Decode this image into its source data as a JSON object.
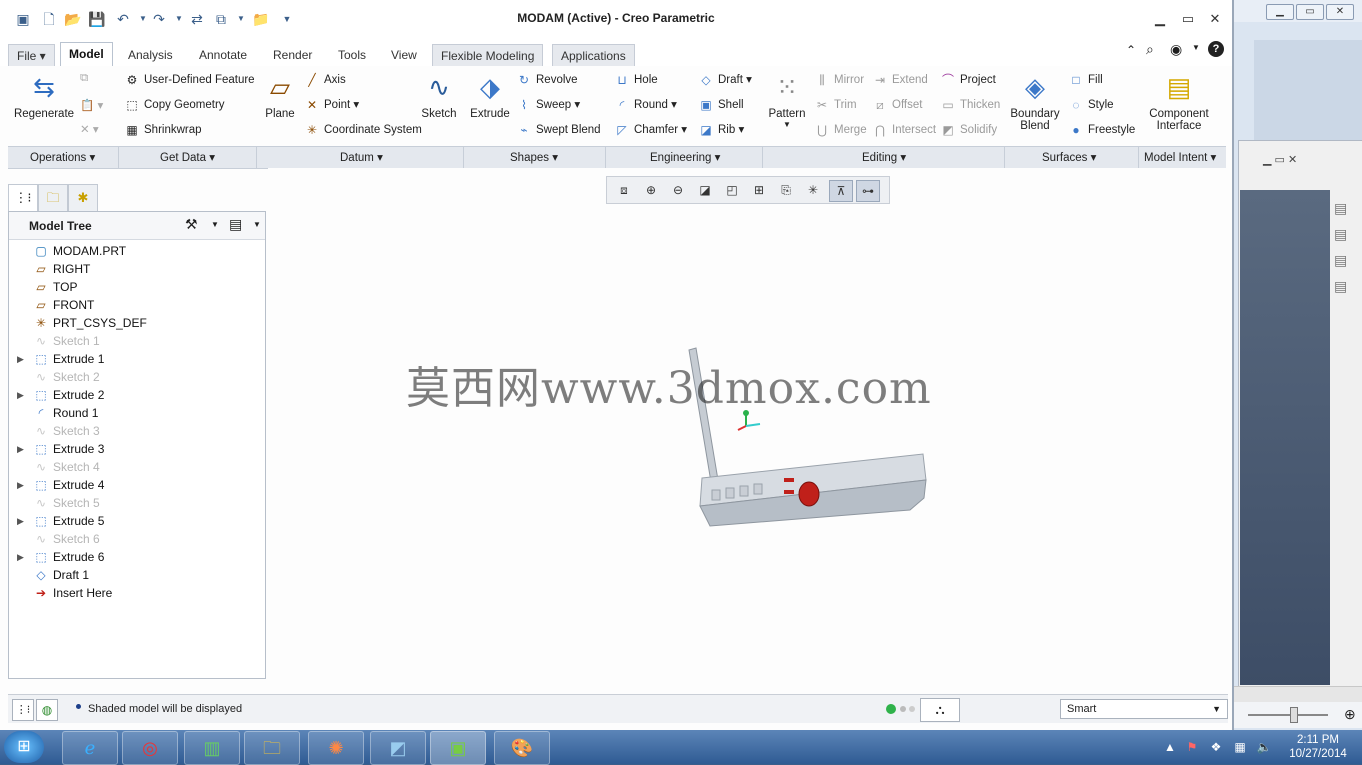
{
  "window": {
    "title": "MODAM (Active) - Creo Parametric"
  },
  "tabs": [
    "File",
    "Model",
    "Analysis",
    "Annotate",
    "Render",
    "Tools",
    "View",
    "Flexible Modeling",
    "Applications"
  ],
  "ribbon": {
    "regenerate": "Regenerate",
    "get_data": [
      "User-Defined Feature",
      "Copy Geometry",
      "Shrinkwrap"
    ],
    "plane": "Plane",
    "datum": [
      "Axis",
      "Point",
      "Coordinate System"
    ],
    "sketch": "Sketch",
    "extrude": "Extrude",
    "shapes": [
      "Revolve",
      "Sweep",
      "Swept Blend"
    ],
    "engineering_left": [
      "Hole",
      "Round",
      "Chamfer"
    ],
    "engineering_right": [
      "Draft",
      "Shell",
      "Rib"
    ],
    "pattern": "Pattern",
    "editing_left": [
      "Mirror",
      "Trim",
      "Merge"
    ],
    "editing_mid": [
      "Extend",
      "Offset",
      "Intersect"
    ],
    "editing_right": [
      "Project",
      "Thicken",
      "Solidify"
    ],
    "boundary_blend": [
      "Boundary",
      "Blend"
    ],
    "surfaces": [
      "Fill",
      "Style",
      "Freestyle"
    ],
    "component_interface": [
      "Component",
      "Interface"
    ]
  },
  "groups": [
    "Operations",
    "Get Data",
    "Datum",
    "Shapes",
    "Engineering",
    "Editing",
    "Surfaces",
    "Model Intent"
  ],
  "model_tree": {
    "title": "Model Tree",
    "nodes": [
      {
        "label": "MODAM.PRT",
        "dim": false,
        "expand": false,
        "icon": "part-icon"
      },
      {
        "label": "RIGHT",
        "dim": false,
        "expand": false,
        "icon": "datum-plane-icon"
      },
      {
        "label": "TOP",
        "dim": false,
        "expand": false,
        "icon": "datum-plane-icon"
      },
      {
        "label": "FRONT",
        "dim": false,
        "expand": false,
        "icon": "datum-plane-icon"
      },
      {
        "label": "PRT_CSYS_DEF",
        "dim": false,
        "expand": false,
        "icon": "csys-icon"
      },
      {
        "label": "Sketch 1",
        "dim": true,
        "expand": false,
        "icon": "sketch-icon"
      },
      {
        "label": "Extrude 1",
        "dim": false,
        "expand": true,
        "icon": "extrude-icon"
      },
      {
        "label": "Sketch 2",
        "dim": true,
        "expand": false,
        "icon": "sketch-icon"
      },
      {
        "label": "Extrude 2",
        "dim": false,
        "expand": true,
        "icon": "extrude-icon"
      },
      {
        "label": "Round 1",
        "dim": false,
        "expand": false,
        "icon": "round-icon"
      },
      {
        "label": "Sketch 3",
        "dim": true,
        "expand": false,
        "icon": "sketch-icon"
      },
      {
        "label": "Extrude 3",
        "dim": false,
        "expand": true,
        "icon": "extrude-icon"
      },
      {
        "label": "Sketch 4",
        "dim": true,
        "expand": false,
        "icon": "sketch-icon"
      },
      {
        "label": "Extrude 4",
        "dim": false,
        "expand": true,
        "icon": "extrude-icon"
      },
      {
        "label": "Sketch 5",
        "dim": true,
        "expand": false,
        "icon": "sketch-icon"
      },
      {
        "label": "Extrude 5",
        "dim": false,
        "expand": true,
        "icon": "extrude-icon"
      },
      {
        "label": "Sketch 6",
        "dim": true,
        "expand": false,
        "icon": "sketch-icon"
      },
      {
        "label": "Extrude 6",
        "dim": false,
        "expand": true,
        "icon": "extrude-icon"
      },
      {
        "label": "Draft 1",
        "dim": false,
        "expand": false,
        "icon": "draft-icon"
      },
      {
        "label": "Insert Here",
        "dim": false,
        "expand": false,
        "icon": "insert-arrow-icon"
      }
    ]
  },
  "watermark": "莫西网www.3dmox.com",
  "status": {
    "message": "Shaded model will be displayed",
    "filter": "Smart"
  },
  "clock": {
    "time": "2:11 PM",
    "date": "10/27/2014"
  },
  "colors": {
    "accent": "#3c78c8",
    "model_body": "#c9cfd6",
    "model_button": "#c0201a"
  }
}
